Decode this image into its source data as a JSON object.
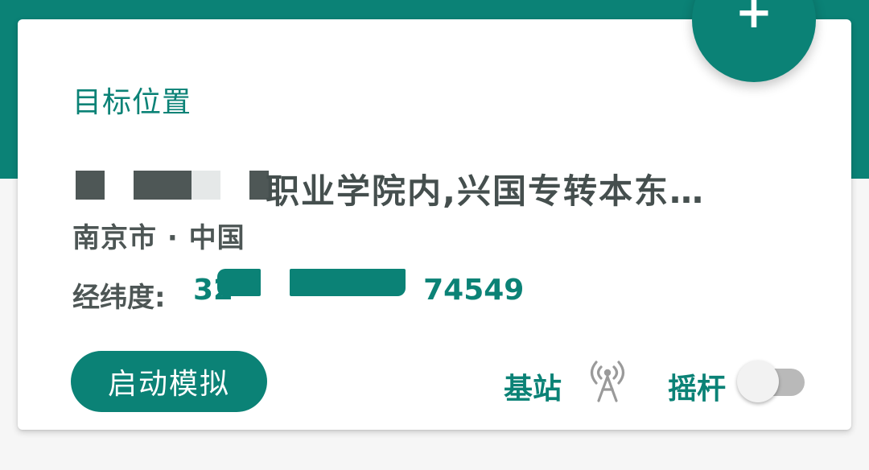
{
  "card": {
    "title": "目标位置",
    "address_visible": "职业学院内,兴国专转本东…",
    "city_country": "南京市 · 中国",
    "coord_label": "经纬度:",
    "coord_prefix": "32",
    "coord_suffix": "74549"
  },
  "actions": {
    "start_label": "启动模拟",
    "station_label": "基站",
    "station_icon": "cell-tower-icon",
    "joystick_label": "摇杆",
    "joystick_enabled": false
  },
  "fab": {
    "icon": "plus-icon",
    "glyph": "+"
  },
  "colors": {
    "accent": "#0b8276",
    "text_dark": "#454f4e",
    "switch_off_track": "#b9b9b9",
    "background": "#f6f6f6"
  }
}
